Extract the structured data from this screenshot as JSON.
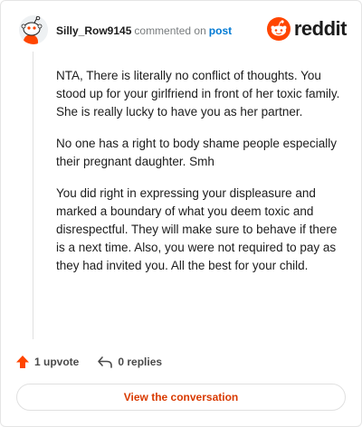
{
  "comment": {
    "username": "Silly_Row9145",
    "commented_on": "commented on",
    "post_link": "post",
    "paragraphs": [
      "NTA, There is literally no conflict of thoughts. You stood up for your girlfriend in front of her toxic family. She is really lucky to have you as her partner.",
      "No one has a right to body shame people especially their pregnant daughter. Smh",
      "You did right in expressing your displeasure and marked a boundary of what you deem toxic and disrespectful. They will make sure to behave if there is a next time. Also, you were not required to pay as they had invited you. All the best for your child."
    ]
  },
  "brand": {
    "name": "reddit",
    "icon": "reddit-logo-icon",
    "color": "#ff4500"
  },
  "actions": {
    "upvotes": "1 upvote",
    "replies": "0 replies",
    "upvote_icon": "upvote-arrow-icon",
    "reply_icon": "reply-arrow-icon"
  },
  "footer": {
    "view_label": "View the conversation"
  },
  "colors": {
    "accent": "#d93a00",
    "link": "#0079d3",
    "upvote": "#ff4500"
  }
}
